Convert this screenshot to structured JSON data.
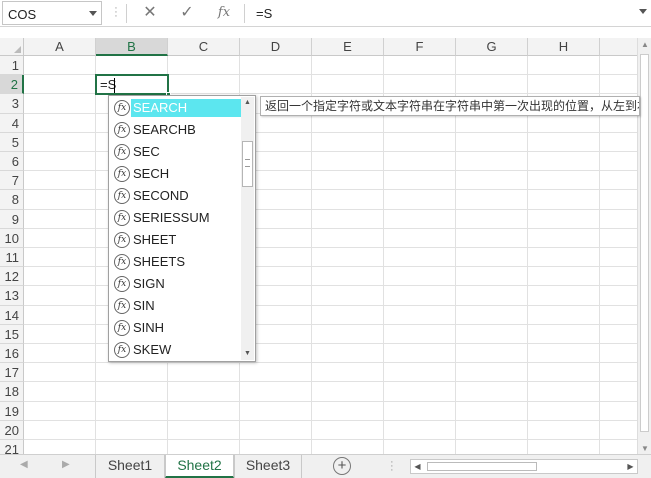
{
  "formula_bar": {
    "name_box": "COS",
    "cancel_icon": "✕",
    "enter_icon": "✓",
    "fx_label": "fx",
    "formula": "=S"
  },
  "columns": [
    "A",
    "B",
    "C",
    "D",
    "E",
    "F",
    "G",
    "H"
  ],
  "rows": [
    "1",
    "2",
    "3",
    "4",
    "5",
    "6",
    "7",
    "8",
    "9",
    "10",
    "11",
    "12",
    "13",
    "14",
    "15",
    "16",
    "17",
    "18",
    "19",
    "20",
    "21"
  ],
  "active_cell": {
    "ref": "B2",
    "value": "=S"
  },
  "autocomplete": {
    "items": [
      "SEARCH",
      "SEARCHB",
      "SEC",
      "SECH",
      "SECOND",
      "SERIESSUM",
      "SHEET",
      "SHEETS",
      "SIGN",
      "SIN",
      "SINH",
      "SKEW"
    ],
    "selected_index": 0,
    "icon": "fx",
    "tooltip": "返回一个指定字符或文本字符串在字符串中第一次出现的位置，从左到右查找"
  },
  "sheets": {
    "tabs": [
      "Sheet1",
      "Sheet2",
      "Sheet3"
    ],
    "active": "Sheet2",
    "add_label": "+"
  },
  "colors": {
    "accent": "#217346",
    "selection": "#5ce6ef"
  }
}
